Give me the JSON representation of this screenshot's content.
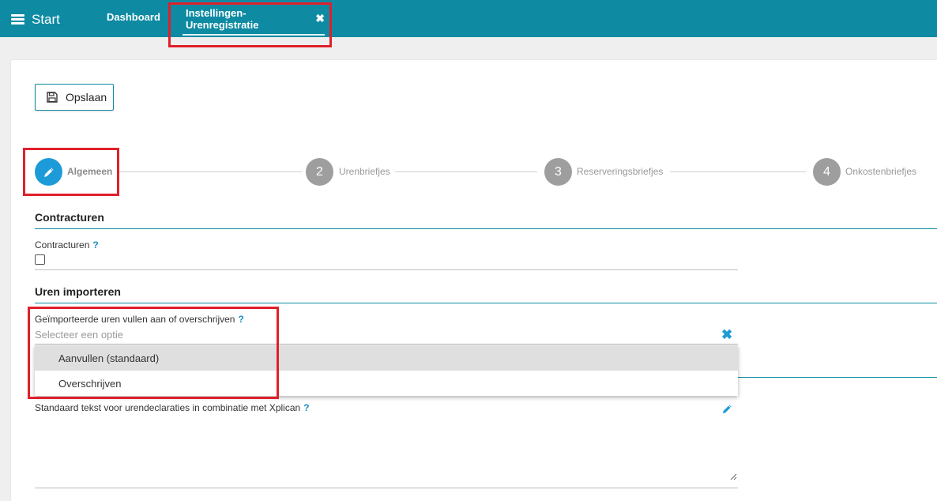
{
  "header": {
    "start_label": "Start",
    "tabs": [
      {
        "label": "Dashboard"
      },
      {
        "label": "Instellingen-Urenregistratie"
      }
    ]
  },
  "toolbar": {
    "save_label": "Opslaan"
  },
  "stepper": {
    "steps": [
      {
        "number": "",
        "label": "Algemeen",
        "active": true,
        "icon": "pencil-icon"
      },
      {
        "number": "2",
        "label": "Urenbriefjes",
        "active": false
      },
      {
        "number": "3",
        "label": "Reserveringsbriefjes",
        "active": false
      },
      {
        "number": "4",
        "label": "Onkostenbriefjes",
        "active": false
      }
    ]
  },
  "sections": {
    "contracturen": {
      "title": "Contracturen",
      "field_label": "Contracturen",
      "help": "?",
      "checked": false
    },
    "uren_importeren": {
      "title": "Uren importeren",
      "field_label": "Geïmporteerde uren vullen aan of overschrijven",
      "help": "?",
      "placeholder": "Selecteer een optie",
      "options": [
        "Aanvullen (standaard)",
        "Overschrijven"
      ]
    },
    "tekst": {
      "field_label": "Standaard tekst voor urendeclaraties in combinatie met Xplican",
      "help": "?"
    }
  },
  "colors": {
    "brand": "#0e8ba3",
    "active_step": "#1d9bd8",
    "inactive_step": "#9e9e9e",
    "highlight_box": "#e0202a"
  }
}
